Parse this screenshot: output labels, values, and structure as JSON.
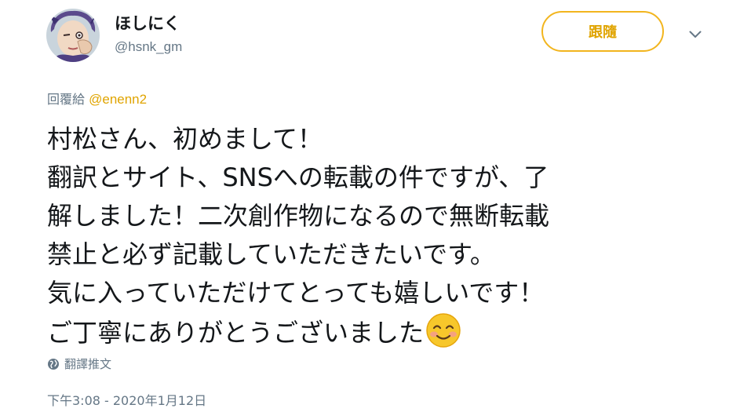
{
  "author": {
    "display_name": "ほしにく",
    "handle": "@hsnk_gm"
  },
  "follow_button": {
    "label": "跟隨"
  },
  "reply": {
    "prefix": "回覆給",
    "mention": "@enenn2"
  },
  "tweet": {
    "lines": [
      "村松さん、初めまして！",
      "翻訳とサイト、SNSへの転載の件ですが、了",
      "解しました！二次創作物になるので無断転載",
      "禁止と必ず記載していただきたいです。",
      "気に入っていただけてとっても嬉しいです！",
      "ご丁寧にありがとうございました"
    ],
    "emoji": "smiling-face-with-blush"
  },
  "translate": {
    "label": "翻譯推文"
  },
  "timestamp": "下午3:08 - 2020年1月12日",
  "colors": {
    "accent": "#f2b51e",
    "accent_text": "#e0a400",
    "secondary_text": "#657786",
    "primary_text": "#14171a"
  }
}
